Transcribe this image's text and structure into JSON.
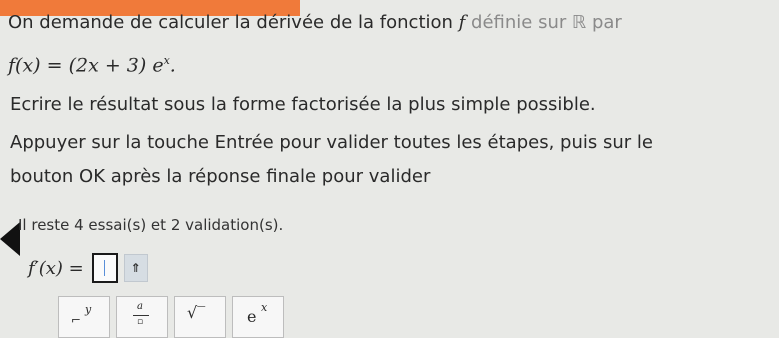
{
  "question": {
    "line1_main": "On demande de calculer la dérivée de la fonction ",
    "line1_f": "f",
    "line1_tail": " définie sur ℝ par",
    "formula": "f(x) = (2x + 3) e",
    "formula_sup": "x",
    "formula_end": ".",
    "instruction1": "Ecrire le résultat sous la forme factorisée la plus simple possible.",
    "instruction2": "Appuyer sur la touche Entrée pour valider toutes les étapes, puis sur le",
    "instruction3": "bouton OK après la réponse finale pour valider"
  },
  "attempts": "Il reste 4 essai(s) et 2 validation(s).",
  "answer": {
    "label": "f′(x) =",
    "value": "",
    "submit_glyph": "⇑"
  },
  "keypad": {
    "keys": [
      {
        "name": "power-key",
        "label": "y"
      },
      {
        "name": "fraction-key",
        "label": "a"
      },
      {
        "name": "sqrt-key",
        "label": "√‾"
      },
      {
        "name": "exp-key",
        "label": "e",
        "sup": "x"
      }
    ]
  },
  "colors": {
    "accent_top": "#f07a3a",
    "background": "#e8e9e6",
    "caret": "#5a8fd8"
  }
}
